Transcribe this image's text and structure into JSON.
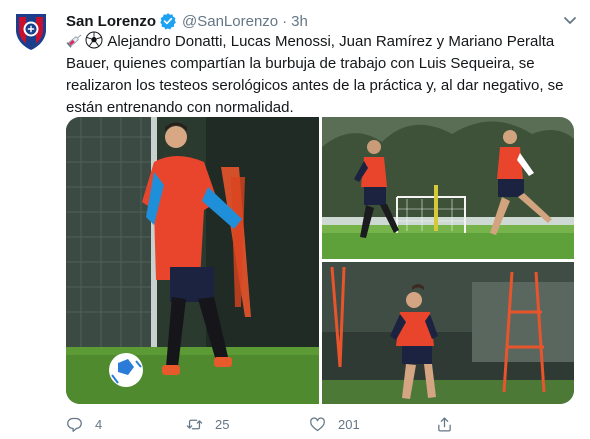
{
  "tweet": {
    "author": {
      "name": "San Lorenzo",
      "handle": "@SanLorenzo",
      "separator": "·",
      "time": "3h"
    },
    "text_lines": [
      "Alejandro Donatti, Lucas Menossi, Juan Ramírez y Mariano Peralta",
      "Bauer, quienes compartían la burbuja de trabajo con Luis Sequeira, se",
      "realizaron los testeos serológicos antes de la práctica y, al dar negativo, se",
      "están entrenando con normalidad."
    ],
    "leading_emojis": [
      "syringe-icon",
      "soccer-ball-icon"
    ],
    "media": {
      "photos": [
        {
          "description": "player-with-ball"
        },
        {
          "description": "two-players-running"
        },
        {
          "description": "player-by-mannequins"
        }
      ]
    },
    "actions": {
      "reply_count": "4",
      "retweet_count": "25",
      "like_count": "201"
    }
  },
  "colors": {
    "text": "#14171a",
    "secondary": "#657786",
    "verified": "#1da1f2",
    "club_blue": "#1a3e8c",
    "club_red": "#c8102e"
  }
}
